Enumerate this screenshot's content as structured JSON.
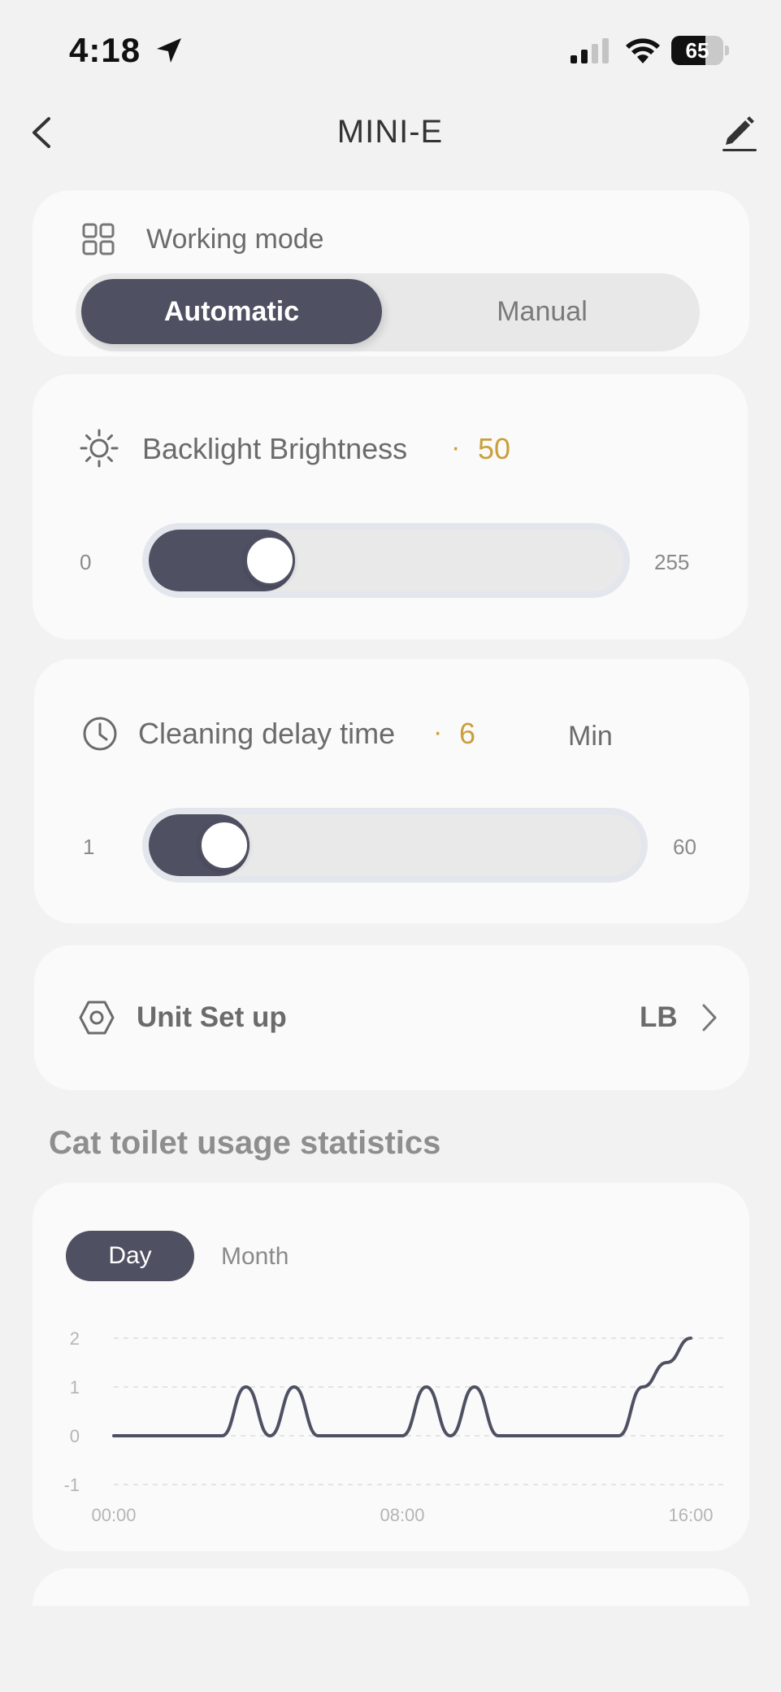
{
  "status_bar": {
    "time": "4:18",
    "battery": "65",
    "battery_level": 0.65,
    "signal_bars_active": 2,
    "signal_bars_total": 4
  },
  "header": {
    "title": "MINI-E"
  },
  "working_mode": {
    "label": "Working mode",
    "options": [
      "Automatic",
      "Manual"
    ],
    "selected": "Automatic"
  },
  "backlight": {
    "label": "Backlight Brightness",
    "separator": "·",
    "value": "50",
    "min": "0",
    "max": "255",
    "value_num": 50,
    "min_num": 0,
    "max_num": 255
  },
  "cleaning_delay": {
    "label": "Cleaning delay time",
    "separator": "·",
    "value": "6",
    "unit": "Min",
    "min": "1",
    "max": "60",
    "value_num": 6,
    "min_num": 1,
    "max_num": 60
  },
  "unit_setup": {
    "label": "Unit Set up",
    "value": "LB"
  },
  "stats": {
    "title": "Cat toilet usage statistics",
    "tabs": [
      "Day",
      "Month"
    ],
    "selected_tab": "Day"
  },
  "colors": {
    "accent_dark": "#4f5163",
    "value_gold": "#c9a03a",
    "background": "#f2f2f2",
    "card": "#fafafa"
  },
  "chart_data": {
    "type": "line",
    "x": [
      "00:00",
      "03:00",
      "03:40",
      "04:20",
      "05:00",
      "05:40",
      "06:20",
      "07:00",
      "07:40",
      "08:00",
      "08:40",
      "09:20",
      "10:00",
      "10:40",
      "11:20",
      "12:00",
      "12:40",
      "13:20",
      "14:00",
      "14:40",
      "15:20",
      "16:00"
    ],
    "series": [
      {
        "values": [
          0,
          0,
          1,
          0,
          1,
          0,
          0,
          0,
          0,
          0,
          1,
          0,
          1,
          0,
          0,
          0,
          0,
          0,
          0,
          1,
          1.5,
          2
        ]
      }
    ],
    "x_ticks": [
      "00:00",
      "08:00",
      "16:00"
    ],
    "y_ticks": [
      "2",
      "1",
      "0",
      "-1"
    ],
    "ylim": [
      -1,
      2
    ],
    "grid": true,
    "line_color": "#4f5163"
  }
}
